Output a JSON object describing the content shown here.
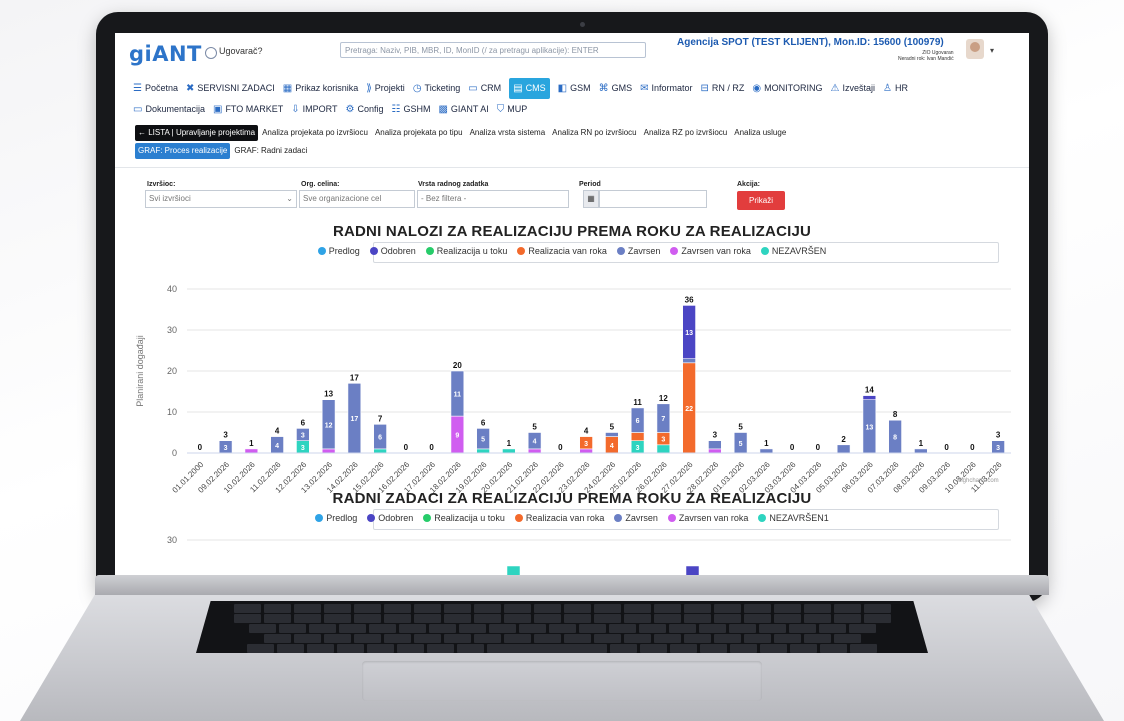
{
  "app": {
    "logo_main": "gi",
    "logo_accent": "ANT",
    "checkbox_label": "Ugovarač?",
    "search_placeholder": "Pretraga: Naziv, PIB, MBR, ID, MonID (/ za pretragu aplikacije): ENTER",
    "agency": "Agencija SPOT (TEST KLIJENT), Mon.ID: 15600 (100979)",
    "agency_sub": "ZIO Ugovaran",
    "agency_sub2": "Neradni rok: Ivan Mandić"
  },
  "menu": [
    {
      "icon": "☰",
      "label": "Početna",
      "name": "menu-pocetna"
    },
    {
      "icon": "✖",
      "label": "SERVISNI ZADACI",
      "name": "menu-servisni-zadaci"
    },
    {
      "icon": "▦",
      "label": "Prikaz korisnika",
      "name": "menu-prikaz-korisnika"
    },
    {
      "icon": "⟫",
      "label": "Projekti",
      "name": "menu-projekti"
    },
    {
      "icon": "◷",
      "label": "Ticketing",
      "name": "menu-ticketing"
    },
    {
      "icon": "▭",
      "label": "CRM",
      "name": "menu-crm"
    },
    {
      "icon": "▤",
      "label": "CMS",
      "name": "menu-cms",
      "active": true
    },
    {
      "icon": "◧",
      "label": "GSM",
      "name": "menu-gsm"
    },
    {
      "icon": "⌘",
      "label": "GMS",
      "name": "menu-gms"
    },
    {
      "icon": "✉",
      "label": "Informator",
      "name": "menu-informator"
    },
    {
      "icon": "⊟",
      "label": "RN / RZ",
      "name": "menu-rn-rz"
    },
    {
      "icon": "◉",
      "label": "MONITORING",
      "name": "menu-monitoring"
    },
    {
      "icon": "⚠",
      "label": "Izveštaji",
      "name": "menu-izvestaji"
    },
    {
      "icon": "♙",
      "label": "HR",
      "name": "menu-hr"
    },
    {
      "icon": "▭",
      "label": "Dokumentacija",
      "name": "menu-dokumentacija"
    },
    {
      "icon": "▣",
      "label": "FTO MARKET",
      "name": "menu-fto-market"
    },
    {
      "icon": "⇩",
      "label": "IMPORT",
      "name": "menu-import"
    },
    {
      "icon": "⚙",
      "label": "Config",
      "name": "menu-config"
    },
    {
      "icon": "☷",
      "label": "GSHM",
      "name": "menu-gshm"
    },
    {
      "icon": "▩",
      "label": "GIANT AI",
      "name": "menu-giant-ai"
    },
    {
      "icon": "⛉",
      "label": "MUP",
      "name": "menu-mup"
    }
  ],
  "tabs": [
    {
      "label": "← LISTA | Upravljanje projektima",
      "style": "black"
    },
    {
      "label": "Analiza projekata po izvršiocu",
      "style": ""
    },
    {
      "label": "Analiza projekata po tipu",
      "style": ""
    },
    {
      "label": "Analiza vrsta sistema",
      "style": ""
    },
    {
      "label": "Analiza RN po izvršiocu",
      "style": ""
    },
    {
      "label": "Analiza RZ po izvršiocu",
      "style": ""
    },
    {
      "label": "Analiza usluge",
      "style": ""
    },
    {
      "label": "GRAF: Proces realizacije",
      "style": "blue"
    },
    {
      "label": "GRAF: Radni zadaci",
      "style": ""
    }
  ],
  "filters": {
    "izvrsilac_label": "Izvršioc:",
    "izvrsilac_value": "Svi izvršioci",
    "org_label": "Org. celina:",
    "org_value": "Sve organizacione cel",
    "vrsta_label": "Vrsta radnog zadatka",
    "vrsta_value": "- Bez filtera -",
    "period_label": "Period",
    "akcija_label": "Akcija:",
    "prikazi": "Prikaži"
  },
  "legend_colors": {
    "Predlog": "#2fa3e6",
    "Odobren": "#4b45c4",
    "Realizacija u toku": "#27cc6a",
    "Realizacia van roka": "#f36a2c",
    "Zavrsen": "#6b7fc4",
    "Zavrsen van roka": "#d05df0",
    "NEZAVRŠEN": "#2ed4c0"
  },
  "chart_data": [
    {
      "type": "bar",
      "title": "RADNI NALOZI ZA REALIZACIJU PREMA ROKU ZA REALIZACIJU",
      "ylabel": "Planirani događaji",
      "ylim": [
        0,
        40
      ],
      "yticks": [
        0,
        10,
        20,
        30,
        40
      ],
      "stacked": true,
      "legend": [
        "Predlog",
        "Odobren",
        "Realizacija u toku",
        "Realizacia van roka",
        "Zavrsen",
        "Zavrsen van roka",
        "NEZAVRŠEN"
      ],
      "categories": [
        "01.01.2000",
        "09.02.2026",
        "10.02.2026",
        "11.02.2026",
        "12.02.2026",
        "13.02.2026",
        "14.02.2026",
        "15.02.2026",
        "16.02.2026",
        "17.02.2026",
        "18.02.2026",
        "19.02.2026",
        "20.02.2026",
        "21.02.2026",
        "22.02.2026",
        "23.02.2026",
        "24.02.2026",
        "25.02.2026",
        "26.02.2026",
        "27.02.2026",
        "28.02.2026",
        "01.03.2026",
        "02.03.2026",
        "03.03.2026",
        "04.03.2026",
        "05.03.2026",
        "06.03.2026",
        "07.03.2026",
        "08.03.2026",
        "09.03.2026",
        "10.03.2026",
        "11.03.2026"
      ],
      "totals": [
        0,
        3,
        1,
        4,
        6,
        13,
        17,
        7,
        0,
        0,
        20,
        6,
        1,
        5,
        0,
        4,
        5,
        11,
        12,
        36,
        3,
        5,
        1,
        0,
        0,
        2,
        14,
        8,
        1,
        0,
        0,
        3
      ],
      "series": [
        {
          "name": "NEZAVRŠEN",
          "values": [
            0,
            0,
            0,
            0,
            3,
            0,
            0,
            1,
            0,
            0,
            0,
            1,
            1,
            0,
            0,
            0,
            0,
            3,
            2,
            0,
            0,
            0,
            0,
            0,
            0,
            0,
            0,
            0,
            0,
            0,
            0,
            0
          ]
        },
        {
          "name": "Zavrsen van roka",
          "values": [
            0,
            0,
            1,
            0,
            0,
            1,
            0,
            0,
            0,
            0,
            9,
            0,
            0,
            1,
            0,
            1,
            0,
            0,
            0,
            0,
            1,
            0,
            0,
            0,
            0,
            0,
            0,
            0,
            0,
            0,
            0,
            0
          ]
        },
        {
          "name": "Realizacia van roka",
          "values": [
            0,
            0,
            0,
            0,
            0,
            0,
            0,
            0,
            0,
            0,
            0,
            0,
            0,
            0,
            0,
            3,
            4,
            2,
            3,
            22,
            0,
            0,
            0,
            0,
            0,
            0,
            0,
            0,
            0,
            0,
            0,
            0
          ]
        },
        {
          "name": "Zavrsen",
          "values": [
            0,
            3,
            0,
            4,
            3,
            12,
            17,
            6,
            0,
            0,
            11,
            5,
            0,
            4,
            0,
            0,
            1,
            6,
            7,
            1,
            2,
            5,
            1,
            0,
            0,
            2,
            13,
            8,
            1,
            0,
            0,
            3
          ]
        },
        {
          "name": "Odobren",
          "values": [
            0,
            0,
            0,
            0,
            0,
            0,
            0,
            0,
            0,
            0,
            0,
            0,
            0,
            0,
            0,
            0,
            0,
            0,
            0,
            13,
            0,
            0,
            0,
            0,
            0,
            0,
            1,
            0,
            0,
            0,
            0,
            0
          ]
        }
      ]
    },
    {
      "type": "bar",
      "title": "RADNI ZADACI ZA REALIZACIJU PREMA ROKU ZA REALIZACIJU",
      "legend": [
        "Predlog",
        "Odobren",
        "Realizacija u toku",
        "Realizacia van roka",
        "Zavrsen",
        "Zavrsen van roka",
        "NEZAVRŠEN1"
      ],
      "ytick_visible": 30
    }
  ],
  "credits": "Highcharts.com"
}
